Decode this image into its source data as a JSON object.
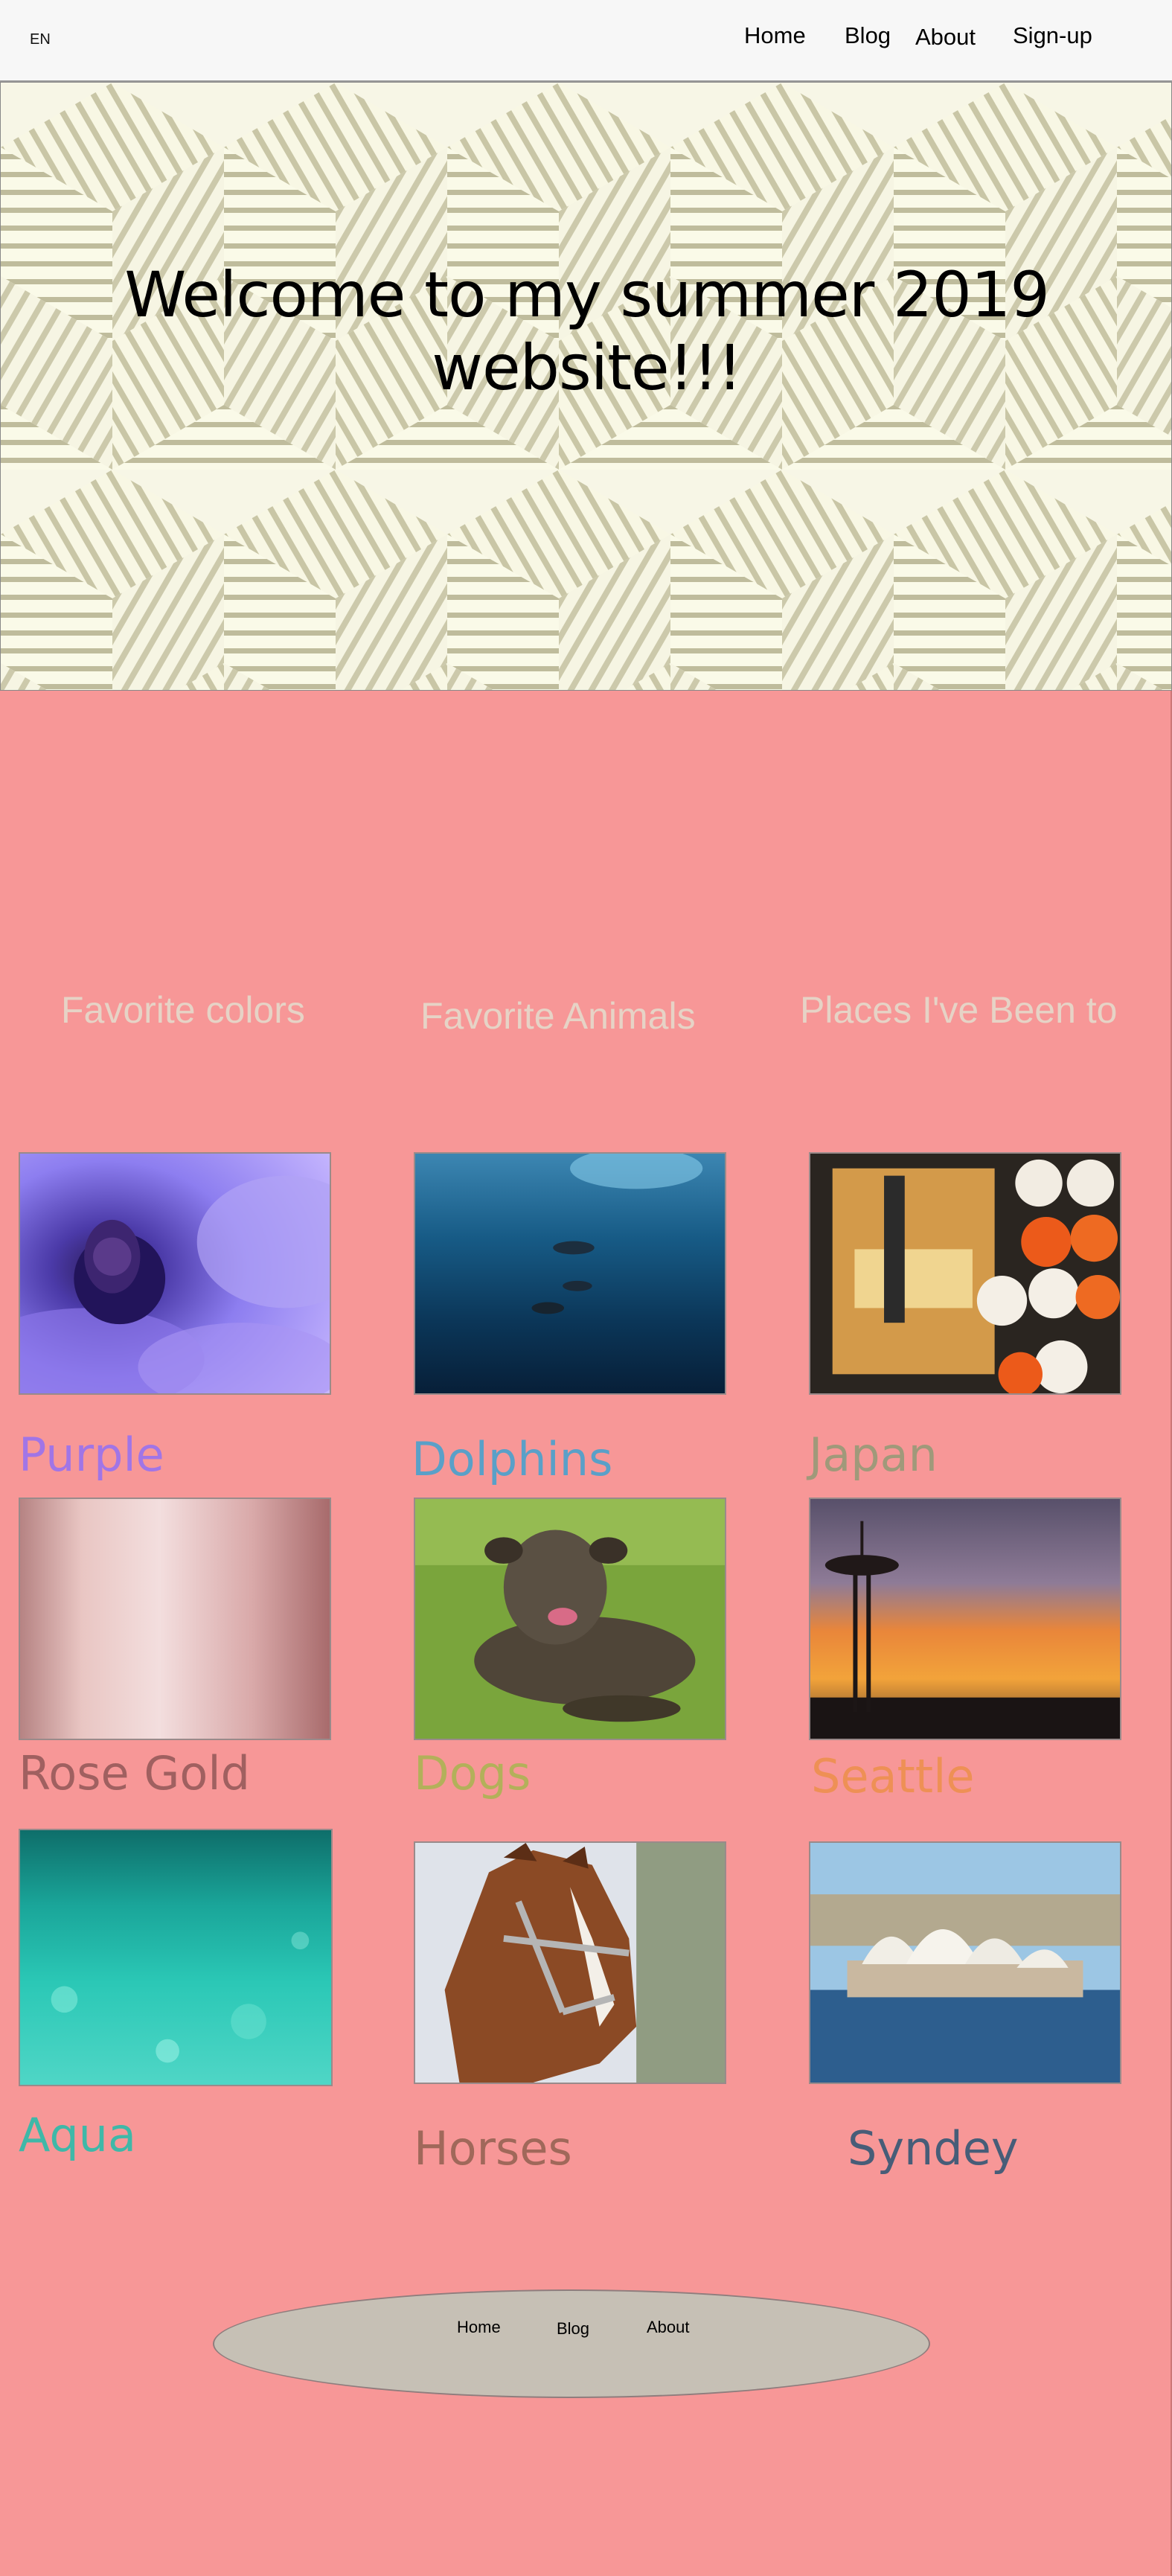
{
  "topnav": {
    "lang": "EN",
    "links": [
      "Home",
      "Blog",
      "About",
      "Sign-up"
    ]
  },
  "hero": {
    "title": "Welcome to my summer 2019 website!!!"
  },
  "columns": {
    "colors": {
      "heading": "Favorite colors",
      "items": [
        {
          "caption": "Purple",
          "color": "#a175e6"
        },
        {
          "caption": "Rose Gold",
          "color": "#a06060"
        },
        {
          "caption": "Aqua",
          "color": "#3fb8a8"
        }
      ]
    },
    "animals": {
      "heading": "Favorite Animals",
      "items": [
        {
          "caption": "Dolphins",
          "color": "#5aa0c8"
        },
        {
          "caption": "Dogs",
          "color": "#b3b05a"
        },
        {
          "caption": "Horses",
          "color": "#a0685a"
        }
      ]
    },
    "places": {
      "heading": "Places I've Been to",
      "items": [
        {
          "caption": "Japan",
          "color": "#a0997a"
        },
        {
          "caption": "Seattle",
          "color": "#ee9055"
        },
        {
          "caption": "Syndey",
          "color": "#475d78"
        }
      ]
    }
  },
  "footer": {
    "links": [
      "Home",
      "Blog",
      "About"
    ]
  },
  "colors": {
    "page_background": "#f79797",
    "header_background": "#f7f7f7",
    "heading_text": "#e6d3c6",
    "footer_oval": "#c6c0b5"
  }
}
